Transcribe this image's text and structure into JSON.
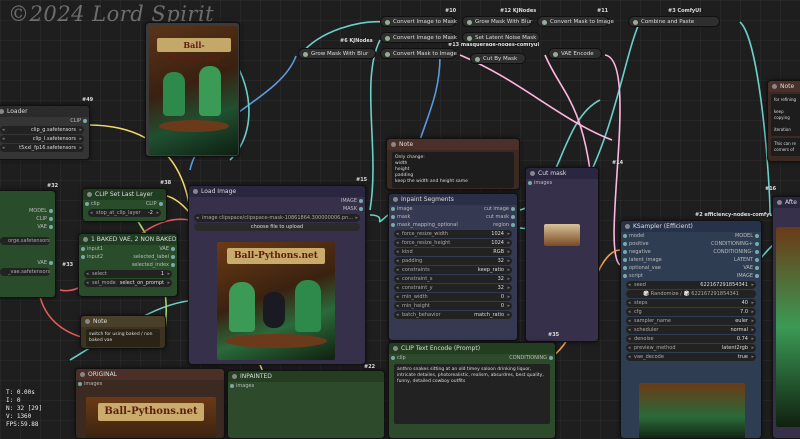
{
  "watermark": "©2024 Lord Spirit",
  "stats": {
    "time": "T: 0.00s",
    "i": "I: 0",
    "n": "N: 32 [29]",
    "v": "V: 1360",
    "fps": "FPS:59.88"
  },
  "pills": {
    "convert_image_to_mask_1": "Convert Image to Mask",
    "grow_mask_with_blur_top": "Grow Mask With Blur",
    "convert_mask_to_image_1": "Convert Mask to Image",
    "combine_and_paste": "Combine and Paste",
    "grow_mask_with_blur_left": "Grow Mask With Blur",
    "convert_image_to_mask_2": "Convert Image to Mask",
    "set_latent_noise_mask": "Set Latent Noise Mask",
    "convert_mask_to_image_2": "Convert Mask to Image",
    "cut_by_mask": "Cut By Mask",
    "vae_encode": "VAE Encode"
  },
  "ids": {
    "n10": "#10",
    "n12": "#12 KJNodes",
    "n11": "#11",
    "n3": "#3 ComfyUI",
    "n6": "#6 KJNodes",
    "n13": "#13 masquerade-nodes-comfyui",
    "n49": "#49",
    "n32": "#32",
    "n38": "#38",
    "n15": "#15",
    "n14": "#14",
    "n2": "#2 efficiency-nodes-comfyui",
    "n22": "#22",
    "n35": "#35",
    "n16": "#16",
    "n33": "#33"
  },
  "loader": {
    "title": "Loader",
    "clip_out": "CLIP",
    "vals": [
      "clip_g.safetensors",
      "clip_l.safetensors",
      "t5xxl_fp16.safetensors"
    ]
  },
  "clip_last_layer": {
    "title": "CLIP Set Last Layer",
    "clip": "clip",
    "out": "CLIP",
    "stop_label": "stop_at_clip_layer",
    "stop_val": "-2"
  },
  "left_model": {
    "model": "MODEL",
    "clip": "CLIP",
    "vae": "VAE",
    "ckpt": "orge.safetensors",
    "vae_name": "_vae.safetensors"
  },
  "baked_vae": {
    "title": "1 BAKED VAE, 2 NON BAKED",
    "in1": "input1",
    "in2": "input2",
    "out_vae": "VAE",
    "out_sel_label": "selected_label",
    "out_sel_index": "selected_index",
    "select_label": "select",
    "select_val": "1",
    "mode_label": "sel_mode",
    "mode_val": "select_on_prompt"
  },
  "note_left": {
    "title": "Note",
    "text": "switch for using baked / non baked vae"
  },
  "load_image": {
    "title": "Load Image",
    "out_image": "IMAGE",
    "out_mask": "MASK",
    "image_label": "image",
    "image_val": "clipspace/clipspace-mask-10861864.300000006.pn...",
    "upload": "choose file to upload",
    "logo_text": "Ball-Pythons.net"
  },
  "note_center": {
    "title": "Note",
    "text": "Only change:\nwidth\nheight\npadding\nkeep the width and height same"
  },
  "inpaint_segments": {
    "title": "Inpaint Segments",
    "inputs": [
      "image",
      "mask",
      "mask_mapping_optional"
    ],
    "outputs": [
      "cut image",
      "cut mask",
      "region"
    ],
    "widgets": [
      {
        "label": "force_resize_width",
        "value": "1024"
      },
      {
        "label": "force_resize_height",
        "value": "1024"
      },
      {
        "label": "kind",
        "value": "RGB"
      },
      {
        "label": "padding",
        "value": "32"
      },
      {
        "label": "constraints",
        "value": "keep_ratio"
      },
      {
        "label": "constraint_x",
        "value": "32"
      },
      {
        "label": "constraint_y",
        "value": "32"
      },
      {
        "label": "min_width",
        "value": "0"
      },
      {
        "label": "min_height",
        "value": "0"
      },
      {
        "label": "batch_behavior",
        "value": "match_ratio"
      }
    ]
  },
  "cut_mask": {
    "title": "Cut mask",
    "images": "images"
  },
  "clip_text": {
    "title": "CLIP Text Encode (Prompt)",
    "clip": "clip",
    "out": "CONDITIONING",
    "text": "anthro snakes sitting at an old timey saloon drinking liquor, intricate detailes, photorealistic, realism, absurdres, best quality, funny, detailed cowboy outfits"
  },
  "original": {
    "title": "ORIGINAL",
    "images": "images",
    "logo_text": "Ball-Pythons.net"
  },
  "inpainted": {
    "title": "INPAINTED",
    "images": "images"
  },
  "ksampler": {
    "title": "KSampler (Efficient)",
    "inputs": [
      "model",
      "positive",
      "negative",
      "latent_image",
      "optional_vae",
      "script"
    ],
    "outputs": [
      "MODEL",
      "CONDITIONING+",
      "CONDITIONING-",
      "LATENT",
      "VAE",
      "IMAGE"
    ],
    "seed_label": "seed",
    "seed_val": "622167291854341",
    "randomize": "🎲 Randomize / 🎲 622167291854341",
    "widgets": [
      {
        "label": "steps",
        "value": "40"
      },
      {
        "label": "cfg",
        "value": "7.0"
      },
      {
        "label": "sampler_name",
        "value": "euler"
      },
      {
        "label": "scheduler",
        "value": "normal"
      },
      {
        "label": "denoise",
        "value": "0.74"
      },
      {
        "label": "preview_method",
        "value": "latent2rgb"
      },
      {
        "label": "vae_decode",
        "value": "true"
      }
    ]
  },
  "note_right": {
    "title": "Note",
    "text": "for refining\n\nkeep copying\n\niteration",
    "text2": "This can re\ncorners of"
  },
  "after": {
    "title": "Afte"
  },
  "image_labels": {
    "poster": "Ball-Pythons.net"
  }
}
